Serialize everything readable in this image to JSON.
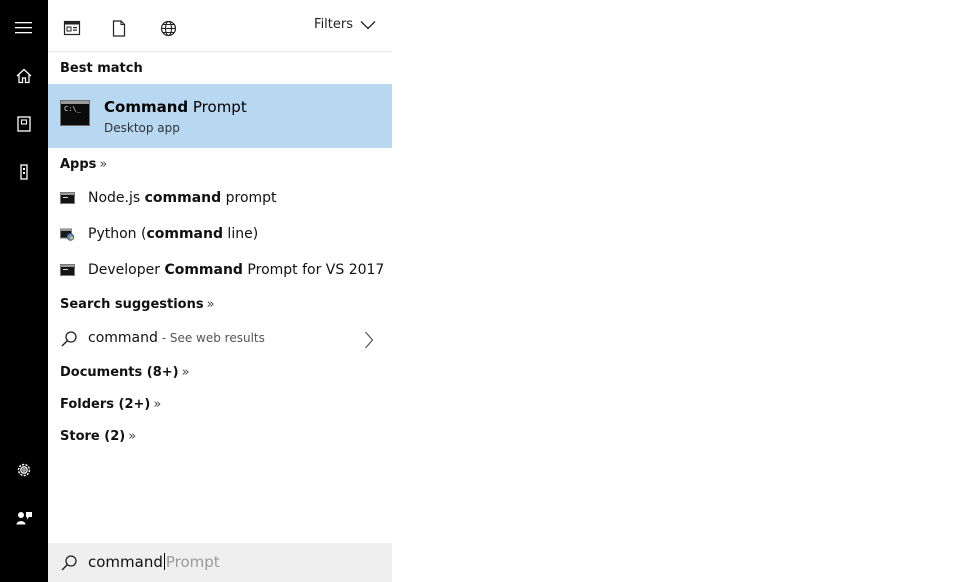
{
  "rail": {
    "items": [
      {
        "icon": "hamburger-menu-icon"
      },
      {
        "icon": "home-icon"
      },
      {
        "icon": "notebook-icon"
      },
      {
        "icon": "tower-icon"
      },
      {
        "icon": "gear-icon"
      },
      {
        "icon": "feedback-icon"
      }
    ]
  },
  "topbar": {
    "scopes": [
      {
        "icon": "apps-scope-icon"
      },
      {
        "icon": "documents-scope-icon"
      },
      {
        "icon": "web-scope-icon"
      }
    ],
    "filters_label": "Filters"
  },
  "best_match": {
    "heading": "Best match",
    "title_bold": "Command",
    "title_rest": " Prompt",
    "subtitle": "Desktop app",
    "icon_text": "C:\\_",
    "highlight_color": "#b7d8f0"
  },
  "apps": {
    "heading": "Apps",
    "chevron": "»",
    "items": [
      {
        "pre": "Node.js ",
        "bold": "command",
        "post": " prompt",
        "icon": "console-icon"
      },
      {
        "pre": "Python (",
        "bold": "command",
        "post": " line)",
        "icon": "python-console-icon"
      },
      {
        "pre": "Developer ",
        "bold": "Command",
        "post": " Prompt for VS 2017",
        "icon": "console-icon"
      }
    ]
  },
  "suggestions": {
    "heading": "Search suggestions",
    "chevron": "»",
    "query": "command",
    "hint": " - See web results"
  },
  "categories": [
    {
      "label": "Documents (8+)",
      "chevron": "»"
    },
    {
      "label": "Folders (2+)",
      "chevron": "»"
    },
    {
      "label": "Store (2)",
      "chevron": "»"
    }
  ],
  "searchbox": {
    "typed": "command",
    "autocomplete": "Prompt",
    "bg": "#efefef"
  }
}
